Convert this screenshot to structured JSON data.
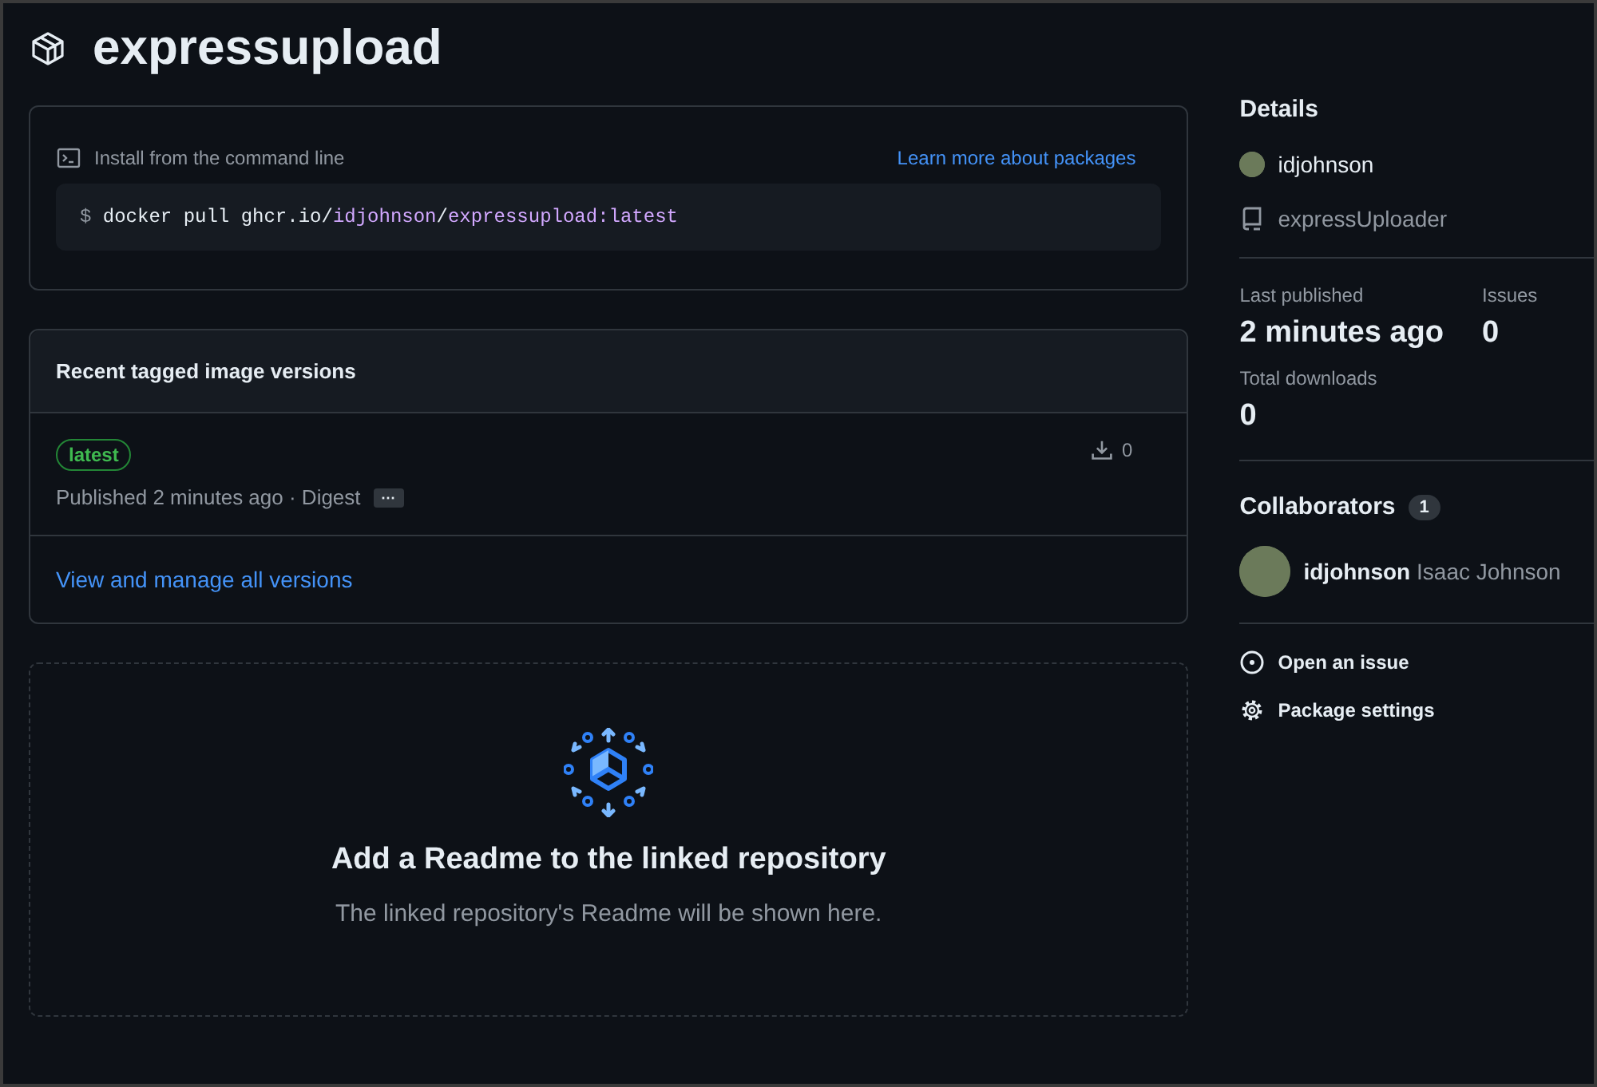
{
  "package": {
    "title": "expressupload"
  },
  "install": {
    "label": "Install from the command line",
    "link": "Learn more about packages",
    "prompt": "$",
    "command": [
      {
        "text": "docker pull ghcr.io/",
        "kind": "plain"
      },
      {
        "text": "idjohnson",
        "kind": "highlight"
      },
      {
        "text": "/",
        "kind": "plain"
      },
      {
        "text": "expressupload:latest",
        "kind": "highlight"
      }
    ]
  },
  "versions": {
    "title": "Recent tagged image versions",
    "items": [
      {
        "tag": "latest",
        "published": "Published 2 minutes ago · Digest",
        "digest_button": "···",
        "downloads": "0"
      }
    ],
    "manage_link": "View and manage all versions"
  },
  "readme": {
    "title": "Add a Readme to the linked repository",
    "text": "The linked repository's Readme will be shown here."
  },
  "details": {
    "title": "Details",
    "owner": "idjohnson",
    "repository": "expressUploader",
    "stats": [
      {
        "label": "Last published",
        "value": "2 minutes ago"
      },
      {
        "label": "Issues",
        "value": "0"
      },
      {
        "label": "Total downloads",
        "value": "0"
      }
    ]
  },
  "collaborators": {
    "title": "Collaborators",
    "count": "1",
    "items": [
      {
        "login": "idjohnson",
        "name": "Isaac Johnson"
      }
    ]
  },
  "actions": [
    {
      "label": "Open an issue",
      "kind": "issue"
    },
    {
      "label": "Package settings",
      "kind": "settings"
    }
  ]
}
